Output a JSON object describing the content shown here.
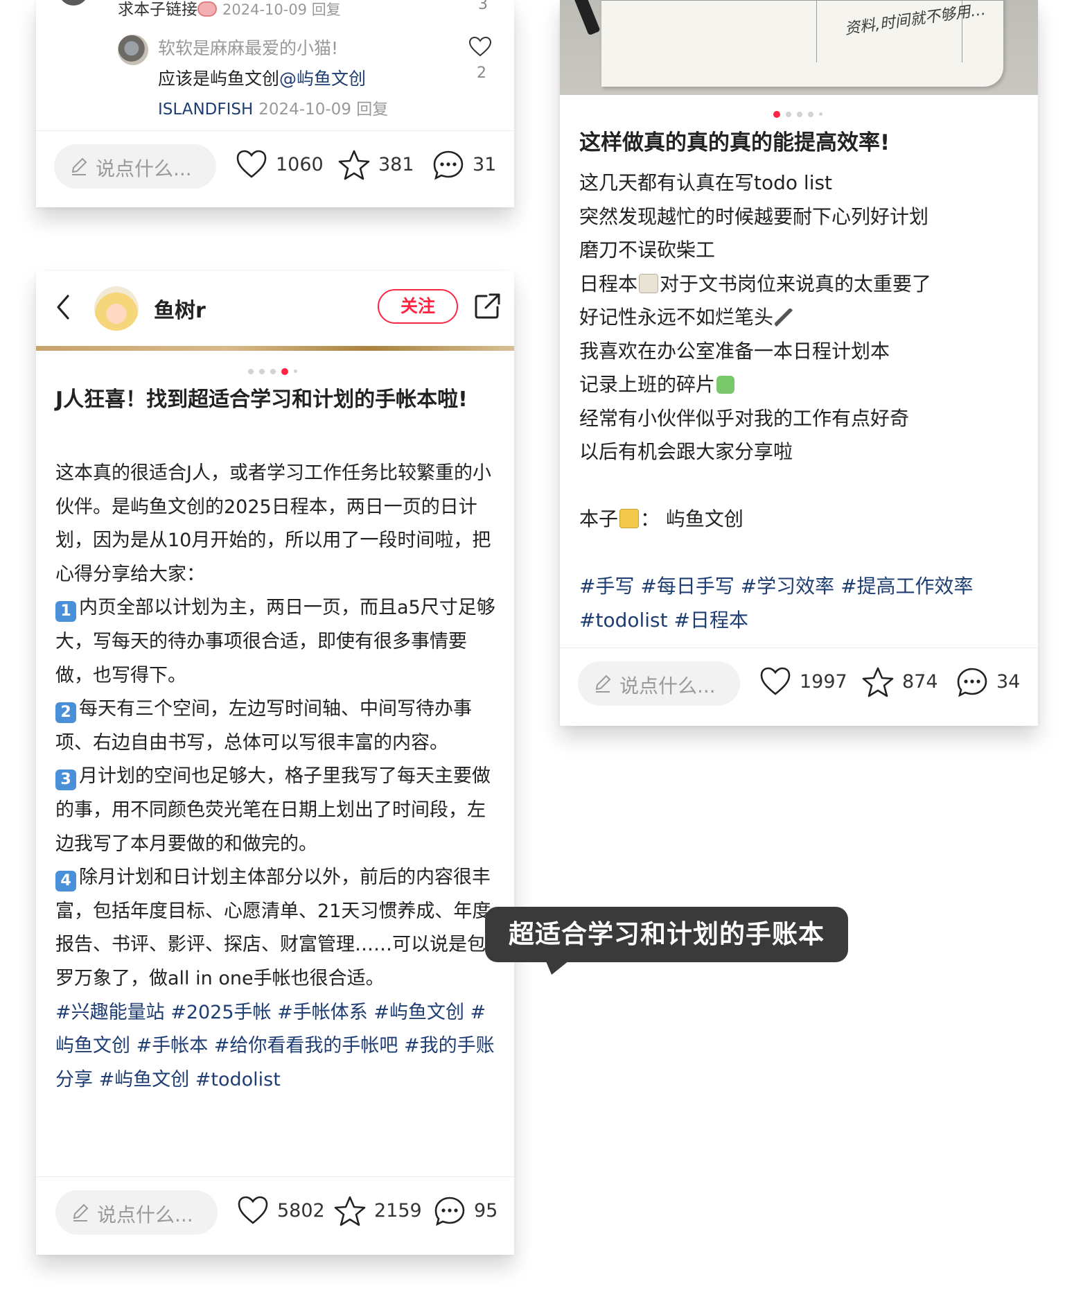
{
  "top_left_card": {
    "comment_line": "求本子链接",
    "comment_meta": "2024-10-09 回复",
    "comment_count": "3",
    "reply": {
      "name": "软软是麻麻最爱的小猫!",
      "text": "应该是屿鱼文创",
      "mention": "@屿鱼文创",
      "nickname": "ISLANDFISH",
      "meta": "2024-10-09 回复",
      "likes": "2"
    },
    "action_bar": {
      "placeholder": "说点什么...",
      "likes": "1060",
      "stars": "381",
      "comments": "31"
    }
  },
  "main_card": {
    "username": "鱼树r",
    "follow_label": "关注",
    "title": "J人狂喜！找到超适合学习和计划的手帐本啦!",
    "body": {
      "intro": "这本真的很适合J人，或者学习工作任务比较繁重的小伙伴。是屿鱼文创的2025日程本，两日一页的日计划，因为是从10月开始的，所以用了一段时间啦，把心得分享给大家：",
      "point1_key": "1",
      "point1": "内页全部以计划为主，两日一页，而且a5尺寸足够大，写每天的待办事项很合适，即使有很多事情要做，也写得下。",
      "point2_key": "2",
      "point2": "每天有三个空间，左边写时间轴、中间写待办事项、右边自由书写，总体可以写很丰富的内容。",
      "point3_key": "3",
      "point3": "月计划的空间也足够大，格子里我写了每天主要做的事，用不同颜色荧光笔在日期上划出了时间段，左边我写了本月要做的和做完的。",
      "point4_key": "4",
      "point4": "除月计划和日计划主体部分以外，前后的内容很丰富，包括年度目标、心愿清单、21天习惯养成、年度报告、书评、影评、探店、财富管理……可以说是包罗万象了，做all in one手帐也很合适。",
      "tags": "#兴趣能量站 #2025手帐 #手帐体系 #屿鱼文创 #屿鱼文创 #手帐本 #给你看看我的手帐吧 #我的手账分享 #屿鱼文创 #todolist"
    },
    "action_bar": {
      "placeholder": "说点什么...",
      "likes": "5802",
      "stars": "2159",
      "comments": "95"
    }
  },
  "right_card": {
    "photo_handwriting": "资料,时间就不够用…",
    "title": "这样做真的真的真的能提高效率!",
    "lines": [
      "这几天都有认真在写todo list",
      "突然发现越忙的时候越要耐下心列好计划",
      "磨刀不误砍柴工",
      "日程本",
      "对于文书岗位来说真的太重要了",
      "好记性永远不如烂笔头",
      "我喜欢在办公室准备一本日程计划本",
      "记录上班的碎片",
      "经常有小伙伴似乎对我的工作有点好奇",
      "以后有机会跟大家分享啦",
      "本子",
      "：  屿鱼文创"
    ],
    "tags": "#手写 #每日手写 #学习效率 #提高工作效率 #todolist #日程本",
    "action_bar": {
      "placeholder": "说点什么...",
      "likes": "1997",
      "stars": "874",
      "comments": "34"
    }
  },
  "tooltip": {
    "text": "超适合学习和计划的手账本"
  },
  "colors": {
    "accent": "#ff2442",
    "tag": "#1e3d73",
    "muted": "#999999"
  }
}
